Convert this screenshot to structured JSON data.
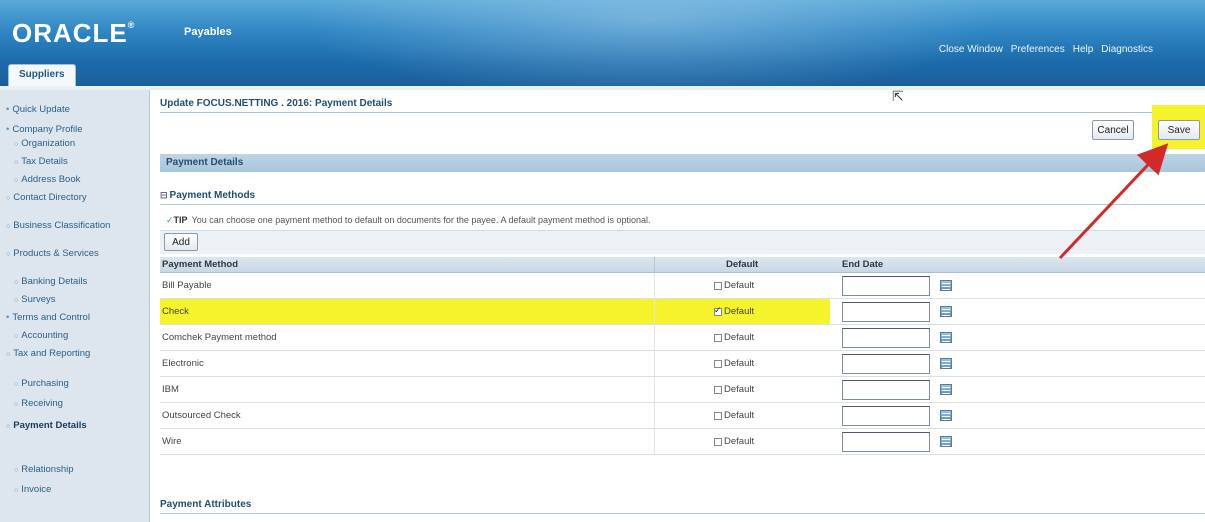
{
  "header": {
    "logo": "ORACLE",
    "app_name": "Payables",
    "links": [
      "Close Window",
      "Preferences",
      "Help",
      "Diagnostics"
    ]
  },
  "tabs": {
    "suppliers": "Suppliers"
  },
  "sidebar": {
    "items": [
      {
        "label": "Quick Update",
        "level": 1
      },
      {
        "label": "Company Profile",
        "level": 1
      },
      {
        "label": "Organization",
        "level": 2
      },
      {
        "label": "Tax Details",
        "level": 2
      },
      {
        "label": "Address Book",
        "level": 2
      },
      {
        "label": "Contact Directory",
        "level": 2
      },
      {
        "label": "Business Classification",
        "level": 2
      },
      {
        "label": "Products & Services",
        "level": 2
      },
      {
        "label": "Banking Details",
        "level": 2
      },
      {
        "label": "Surveys",
        "level": 2
      },
      {
        "label": "Terms and Control",
        "level": 1
      },
      {
        "label": "Accounting",
        "level": 2
      },
      {
        "label": "Tax and Reporting",
        "level": 2
      },
      {
        "label": "Purchasing",
        "level": 2
      },
      {
        "label": "Receiving",
        "level": 2
      },
      {
        "label": "Payment Details",
        "level": 2,
        "current": true
      },
      {
        "label": "Relationship",
        "level": 2
      },
      {
        "label": "Invoice",
        "level": 2
      }
    ]
  },
  "main": {
    "page_title": "Update FOCUS.NETTING . 2016: Payment Details",
    "cancel_label": "Cancel",
    "save_label": "Save",
    "section_title": "Payment Details",
    "methods_title": "Payment Methods",
    "tip_label": "TIP",
    "tip_text": "You can choose one payment method to default on documents for the payee. A default payment method is optional.",
    "add_label": "Add",
    "table": {
      "col_method": "Payment Method",
      "col_default": "Default",
      "col_end_date": "End Date",
      "rows": [
        {
          "method": "Bill Payable",
          "default_label": "Default",
          "checked": false
        },
        {
          "method": "Check",
          "default_label": "Default",
          "checked": true
        },
        {
          "method": "Comchek Payment method",
          "default_label": "Default",
          "checked": false
        },
        {
          "method": "Electronic",
          "default_label": "Default",
          "checked": false
        },
        {
          "method": "IBM",
          "default_label": "Default",
          "checked": false
        },
        {
          "method": "Outsourced Check",
          "default_label": "Default",
          "checked": false
        },
        {
          "method": "Wire",
          "default_label": "Default",
          "checked": false
        }
      ]
    },
    "attributes_title": "Payment Attributes"
  },
  "colors": {
    "highlight": "#f4f32c",
    "header_blue": "#2f86c3",
    "arrow": "#d22a2a"
  }
}
